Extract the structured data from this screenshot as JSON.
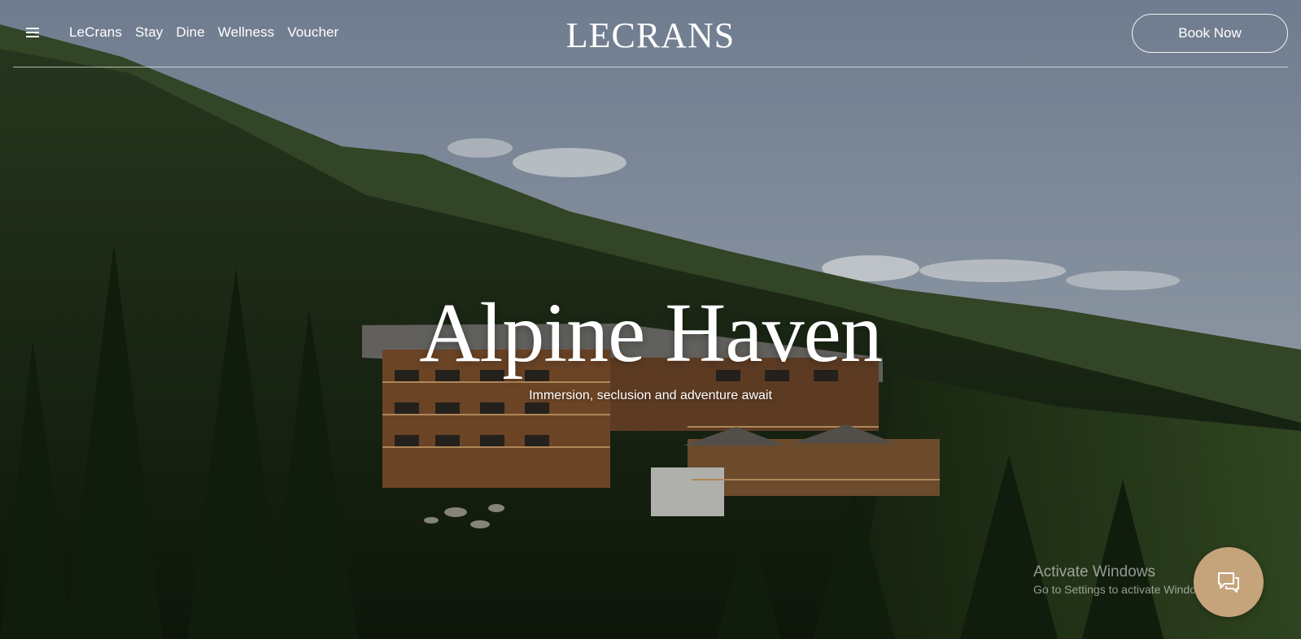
{
  "header": {
    "menu_icon": "hamburger-menu-icon",
    "nav": [
      {
        "label": "LeCrans"
      },
      {
        "label": "Stay"
      },
      {
        "label": "Dine"
      },
      {
        "label": "Wellness"
      },
      {
        "label": "Voucher"
      }
    ],
    "logo": "LECRANS",
    "book_label": "Book Now"
  },
  "hero": {
    "title": "Alpine Haven",
    "subtitle": "Immersion, seclusion and adventure await"
  },
  "watermark": {
    "title": "Activate Windows",
    "subtitle": "Go to Settings to activate Windows."
  },
  "chat": {
    "icon": "chat-bubble-icon"
  },
  "colors": {
    "accent": "#c5a47c",
    "sky": "#8a97a8",
    "forest": "#1c2a14"
  }
}
